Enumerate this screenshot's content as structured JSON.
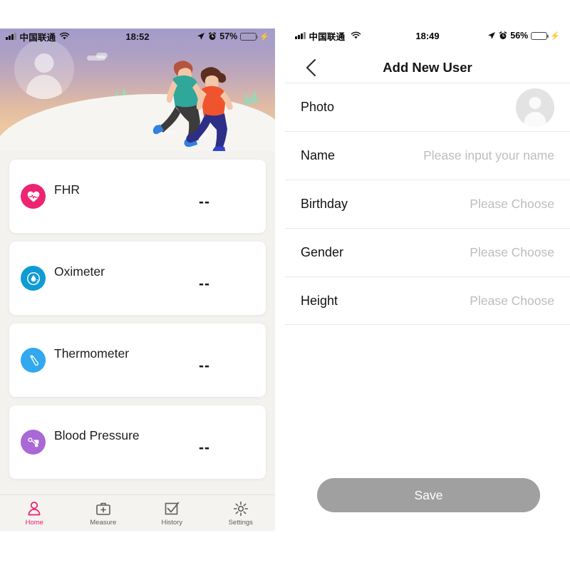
{
  "left_phone": {
    "status_bar": {
      "carrier": "中国联通",
      "time": "18:52",
      "battery_percent": "57%",
      "icons": [
        "signal-bars-icon",
        "wifi-icon",
        "location-arrow-icon",
        "alarm-clock-icon",
        "battery-icon",
        "charging-bolt-icon"
      ],
      "battery_fill_color": "#3ad04a"
    },
    "hero": {
      "avatar_placeholder": "user-avatar-placeholder",
      "illustration": "two-runners-illustration",
      "gradient_top": "#a49ccb",
      "gradient_bottom": "#efc9a2"
    },
    "cards": [
      {
        "title": "FHR",
        "value": "--",
        "icon": "heart-rate-icon",
        "color": "#ee2473"
      },
      {
        "title": "Oximeter",
        "value": "--",
        "icon": "oxygen-droplet-icon",
        "color": "#0f9bd4"
      },
      {
        "title": "Thermometer",
        "value": "--",
        "icon": "thermometer-icon",
        "color": "#31a8ef"
      },
      {
        "title": "Blood Pressure",
        "value": "--",
        "icon": "blood-pressure-cuff-icon",
        "color": "#a968d6"
      }
    ],
    "tabs": [
      {
        "label": "Home",
        "icon": "person-icon",
        "active": true
      },
      {
        "label": "Measure",
        "icon": "medical-case-plus-icon",
        "active": false
      },
      {
        "label": "History",
        "icon": "checkbox-check-icon",
        "active": false
      },
      {
        "label": "Settings",
        "icon": "gear-icon",
        "active": false
      }
    ],
    "active_tab_color": "#ee1d6e"
  },
  "right_phone": {
    "status_bar": {
      "carrier": "中国联通",
      "time": "18:49",
      "battery_percent": "56%",
      "icons": [
        "signal-bars-icon",
        "wifi-icon",
        "location-arrow-icon",
        "alarm-clock-icon",
        "battery-icon",
        "charging-bolt-icon"
      ],
      "battery_fill_color": "#3ad04a"
    },
    "navbar": {
      "back_icon": "chevron-left-icon",
      "title": "Add New User"
    },
    "form_rows": [
      {
        "label": "Photo",
        "value": "",
        "type": "avatar"
      },
      {
        "label": "Name",
        "value": "Please input your name",
        "type": "input"
      },
      {
        "label": "Birthday",
        "value": "Please Choose",
        "type": "picker"
      },
      {
        "label": "Gender",
        "value": "Please Choose",
        "type": "picker"
      },
      {
        "label": "Height",
        "value": "Please Choose",
        "type": "picker"
      }
    ],
    "save_button": {
      "label": "Save",
      "color": "#a0a0a0"
    }
  }
}
